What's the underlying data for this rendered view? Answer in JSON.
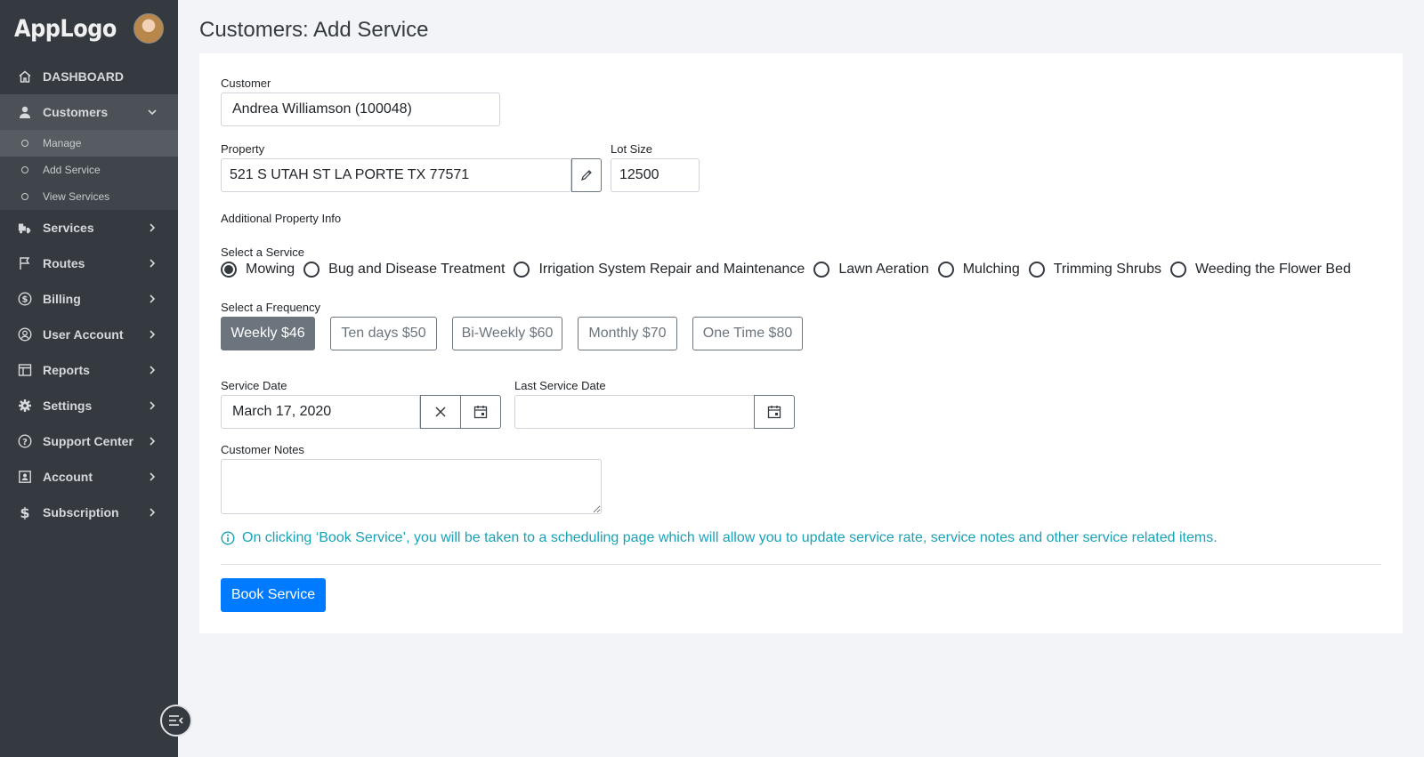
{
  "brand": {
    "logo_text": "AppLogo"
  },
  "sidebar": {
    "items": [
      {
        "label": "DASHBOARD",
        "icon": "home-icon"
      },
      {
        "label": "Customers",
        "icon": "user-icon",
        "expanded": true,
        "children": [
          {
            "label": "Manage"
          },
          {
            "label": "Add Service"
          },
          {
            "label": "View Services"
          }
        ]
      },
      {
        "label": "Services",
        "icon": "truck-icon"
      },
      {
        "label": "Routes",
        "icon": "flag-icon"
      },
      {
        "label": "Billing",
        "icon": "dollar-circle-icon"
      },
      {
        "label": "User Account",
        "icon": "user-circle-icon"
      },
      {
        "label": "Reports",
        "icon": "table-icon"
      },
      {
        "label": "Settings",
        "icon": "gear-icon"
      },
      {
        "label": "Support Center",
        "icon": "help-circle-icon"
      },
      {
        "label": "Account",
        "icon": "id-card-icon"
      },
      {
        "label": "Subscription",
        "icon": "dollar-icon"
      }
    ]
  },
  "page": {
    "title": "Customers: Add Service"
  },
  "form": {
    "customer": {
      "label": "Customer",
      "value": "Andrea Williamson (100048)"
    },
    "property": {
      "label": "Property",
      "value": "521 S UTAH ST LA PORTE TX 77571"
    },
    "lot_size": {
      "label": "Lot Size",
      "value": "12500"
    },
    "additional_info_label": "Additional Property Info",
    "service": {
      "label": "Select a Service",
      "options": [
        "Mowing",
        "Bug and Disease Treatment",
        "Irrigation System Repair and Maintenance",
        "Lawn Aeration",
        "Mulching",
        "Trimming Shrubs",
        "Weeding the Flower Bed"
      ],
      "selected": "Mowing"
    },
    "frequency": {
      "label": "Select a Frequency",
      "options": [
        "Weekly $46",
        "Ten days $50",
        "Bi-Weekly $60",
        "Monthly $70",
        "One Time $80"
      ],
      "selected": "Weekly $46"
    },
    "service_date": {
      "label": "Service Date",
      "value": "March 17, 2020"
    },
    "last_service_date": {
      "label": "Last Service Date",
      "value": ""
    },
    "notes": {
      "label": "Customer Notes",
      "value": ""
    },
    "info_text": "On clicking ‘Book Service’, you will be taken to a scheduling page which will allow you to update service rate, service notes and other service related items.",
    "submit_label": "Book Service"
  },
  "colors": {
    "sidebar_bg": "#343a40",
    "primary": "#007bff",
    "info": "#17a2b8",
    "secondary": "#6c757d"
  }
}
